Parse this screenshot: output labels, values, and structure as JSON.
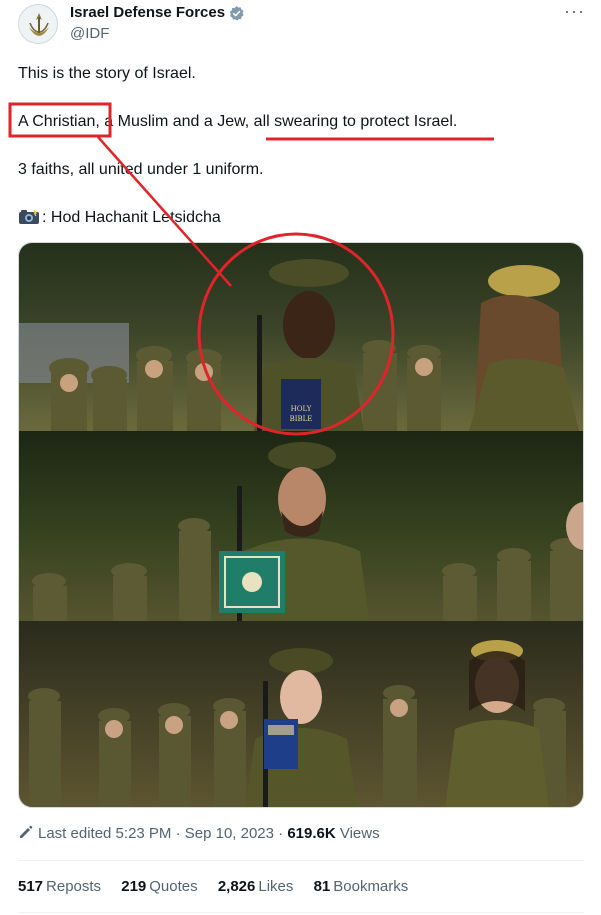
{
  "author": {
    "name": "Israel Defense Forces",
    "handle": "@IDF",
    "verified_color": "#829aab"
  },
  "tweet": {
    "line1": "This is the story of Israel.",
    "line2_part1": "A Christian",
    "line2_part2": ", a Muslim and a Jew, ",
    "line2_part3": "all swearing to protect Israel.",
    "line3": "3 faiths, all united under 1 uniform.",
    "line4_icon": "camera-with-flash-icon",
    "line4": ": Hod Hachanit Letsidcha"
  },
  "photo": {
    "book1_label_a": "HOLY",
    "book1_label_b": "BIBLE"
  },
  "annotation_color": "#e0242b",
  "meta": {
    "edited": "Last edited 5:23 PM · Sep 10, 2023 · ",
    "views_count": "619.6K",
    "views_label": " Views"
  },
  "stats": {
    "reposts_count": "517",
    "reposts_label": "Reposts",
    "quotes_count": "219",
    "quotes_label": "Quotes",
    "likes_count": "2,826",
    "likes_label": "Likes",
    "bookmarks_count": "81",
    "bookmarks_label": "Bookmarks"
  }
}
